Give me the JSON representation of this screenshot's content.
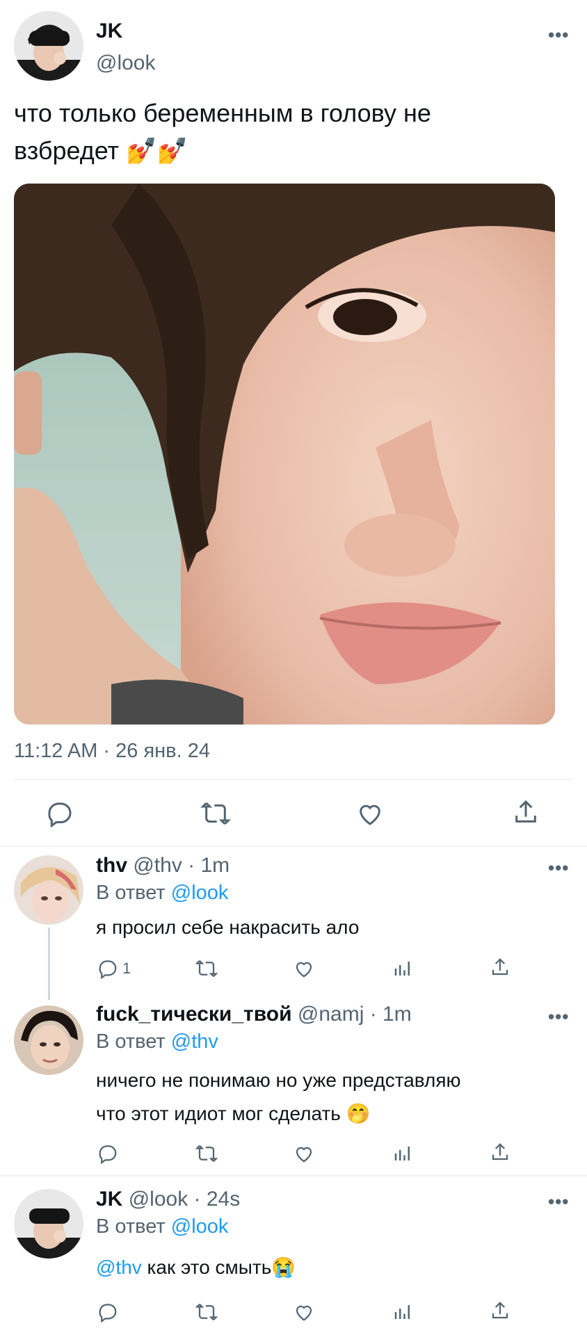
{
  "main_tweet": {
    "display_name": "JK",
    "handle": "@look",
    "text_line1": "что только беременным в голову не",
    "text_line2": "взбредет",
    "emoji": "💅💅",
    "timestamp": "11:12 AM · 26 янв. 24",
    "more": "•••"
  },
  "actions": {
    "reply_icon": "reply-icon",
    "retweet_icon": "retweet-icon",
    "like_icon": "heart-icon",
    "share_icon": "share-icon"
  },
  "replies": [
    {
      "display_name": "thv",
      "handle": "@thv",
      "time": "· 1m",
      "reply_to_prefix": "В ответ",
      "reply_to_handle": "@look",
      "text_line1": "я просил себе накрасить ало",
      "reply_count": "1",
      "more": "•••"
    },
    {
      "display_name": "fuck_тически_твой",
      "handle": "@namj",
      "time": "· 1m",
      "reply_to_prefix": "В ответ",
      "reply_to_handle": "@thv",
      "text_line1": "ничего не понимаю но уже представляю",
      "text_line2": "что этот идиот мог сделать 🤭",
      "more": "•••"
    },
    {
      "display_name": "JK",
      "handle": "@look",
      "time": "· 24s",
      "reply_to_prefix": "В ответ",
      "reply_to_handle": "@look",
      "mention": "@thv",
      "text_rest": " как это смыть😭",
      "more": "•••"
    }
  ]
}
